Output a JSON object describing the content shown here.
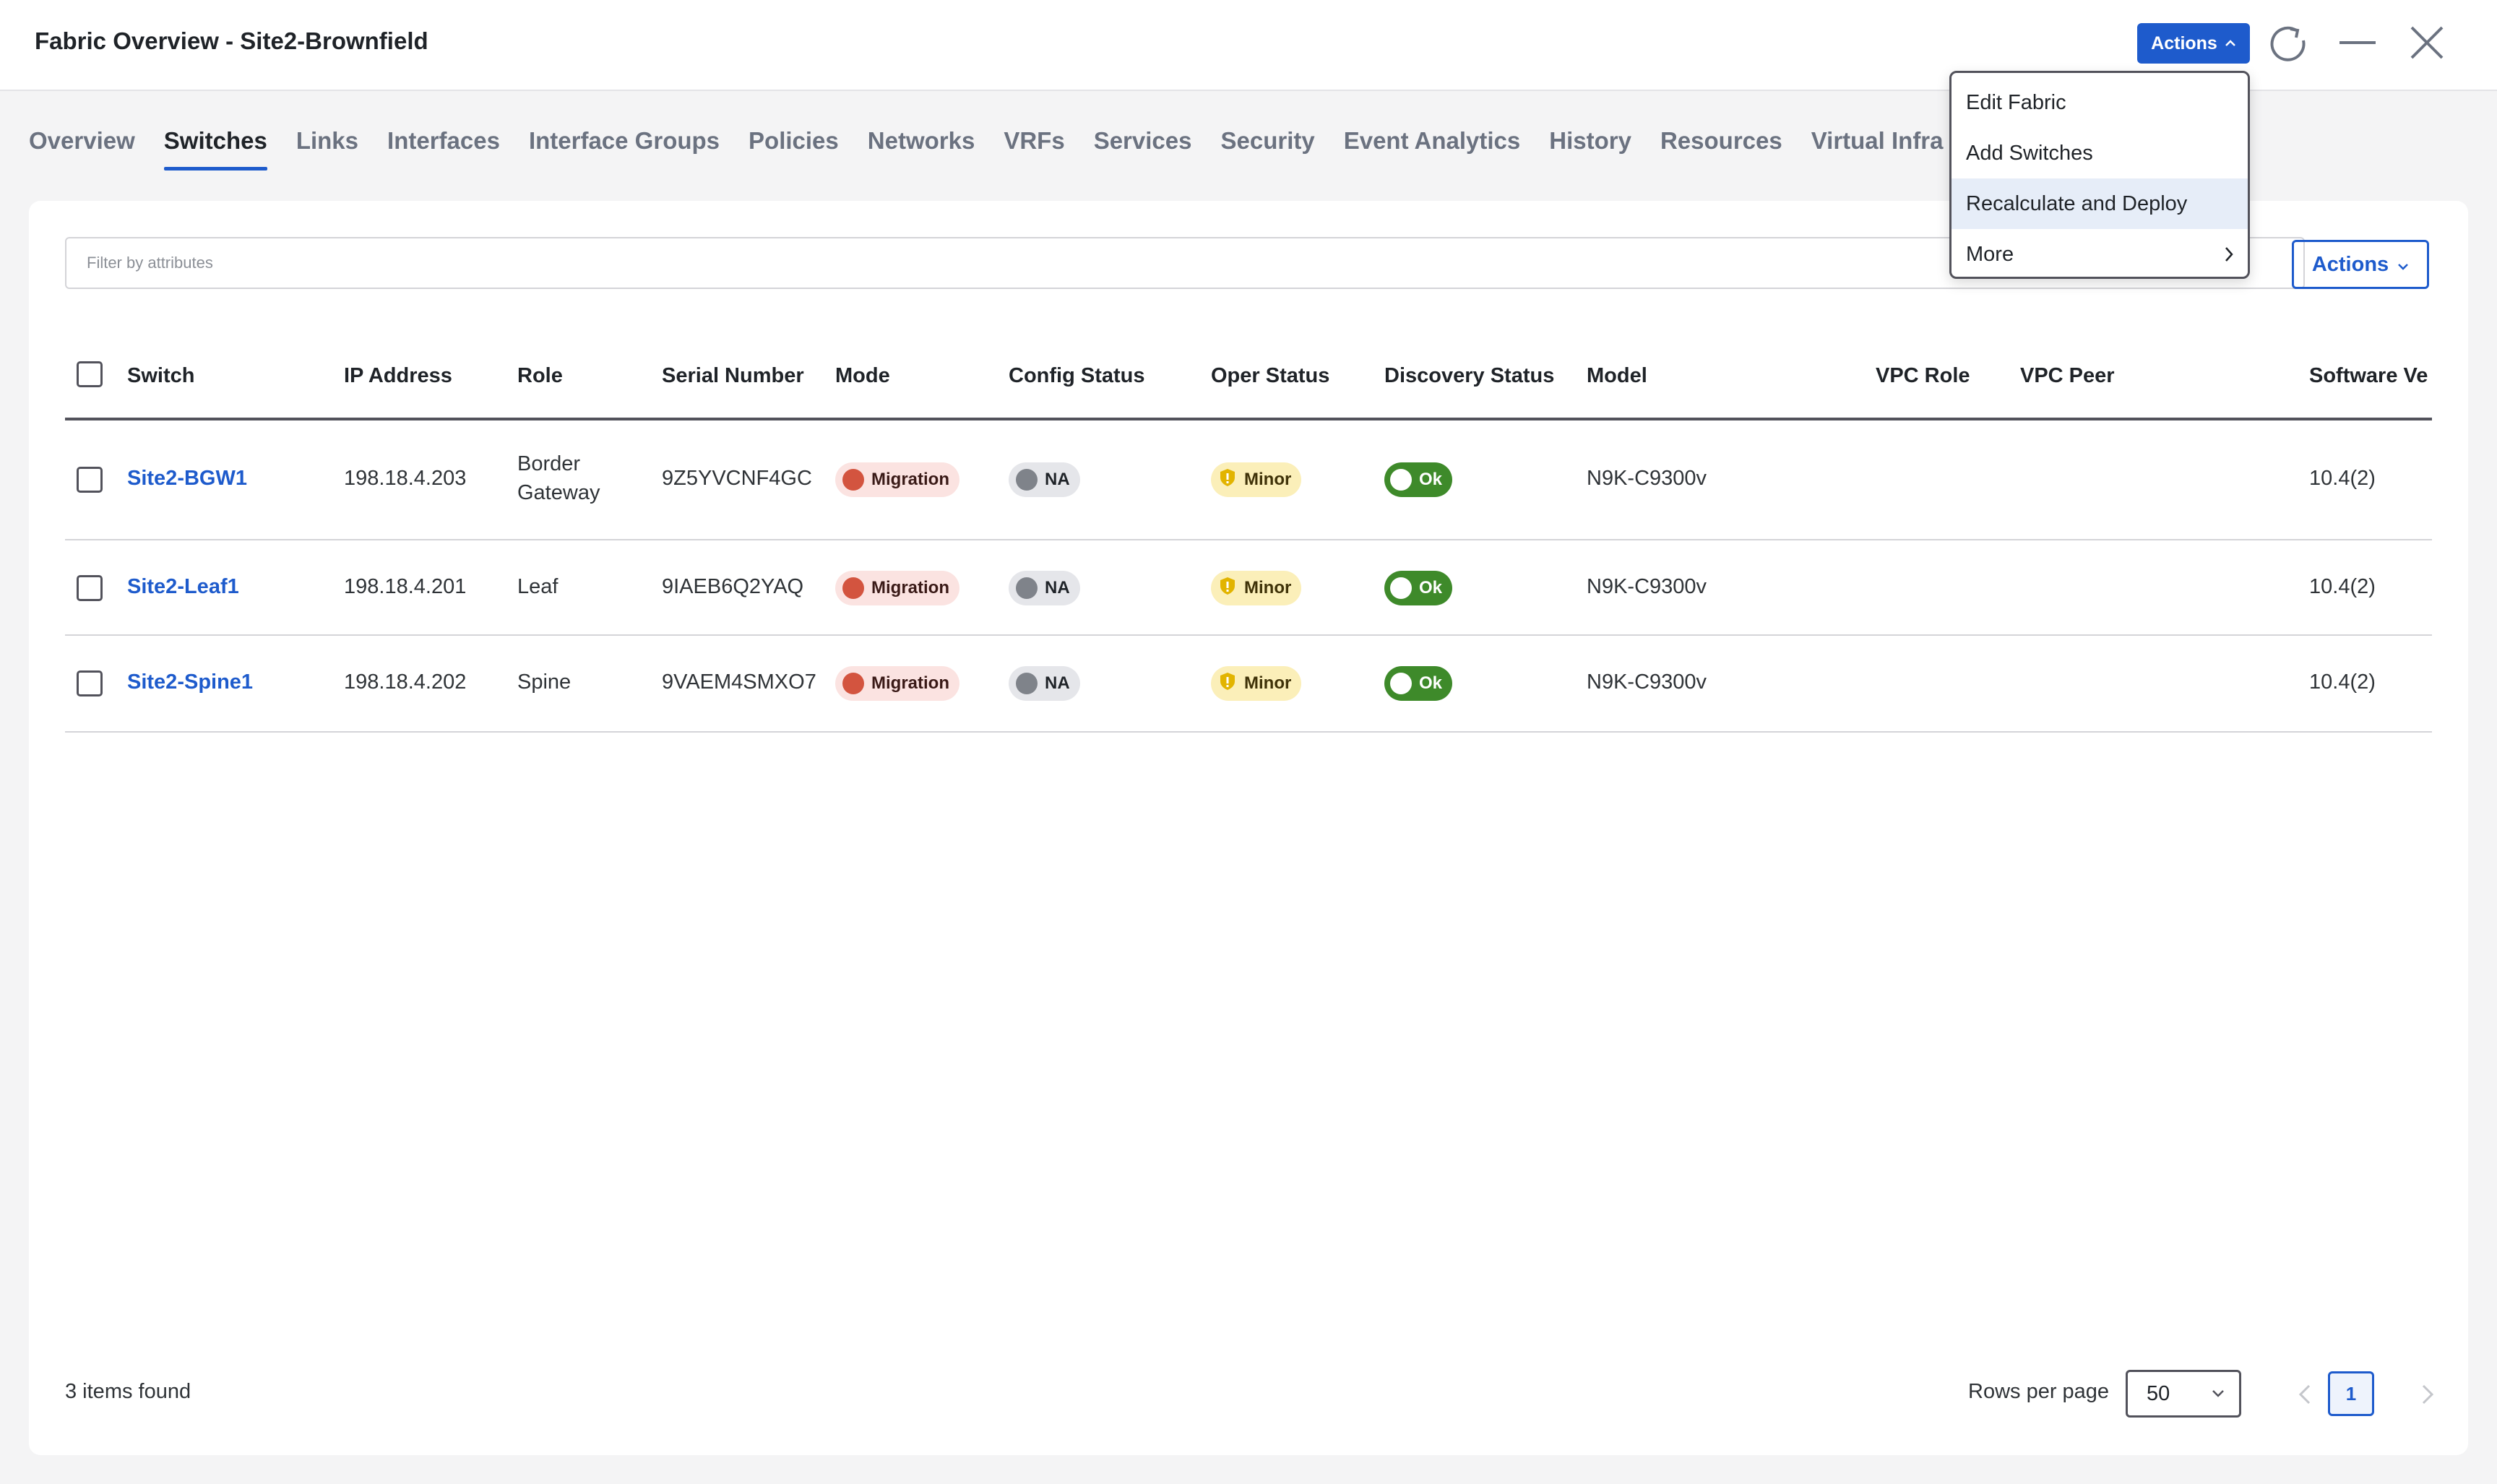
{
  "header": {
    "title": "Fabric Overview - Site2-Brownfield",
    "actions_label": "Actions"
  },
  "tabs": [
    {
      "label": "Overview"
    },
    {
      "label": "Switches"
    },
    {
      "label": "Links"
    },
    {
      "label": "Interfaces"
    },
    {
      "label": "Interface Groups"
    },
    {
      "label": "Policies"
    },
    {
      "label": "Networks"
    },
    {
      "label": "VRFs"
    },
    {
      "label": "Services"
    },
    {
      "label": "Security"
    },
    {
      "label": "Event Analytics"
    },
    {
      "label": "History"
    },
    {
      "label": "Resources"
    },
    {
      "label": "Virtual Infra"
    }
  ],
  "active_tab": "Switches",
  "filter": {
    "placeholder": "Filter by attributes"
  },
  "card_actions_label": "Actions",
  "table": {
    "columns": [
      "Switch",
      "IP Address",
      "Role",
      "Serial Number",
      "Mode",
      "Config Status",
      "Oper Status",
      "Discovery Status",
      "Model",
      "VPC Role",
      "VPC Peer",
      "Software Ve"
    ],
    "rows": [
      {
        "switch": "Site2-BGW1",
        "ip": "198.18.4.203",
        "role_line1": "Border",
        "role_line2": "Gateway",
        "serial": "9Z5YVCNF4GC",
        "mode": "Migration",
        "config": "NA",
        "oper": "Minor",
        "discovery": "Ok",
        "model": "N9K-C9300v",
        "vpc_role": "",
        "vpc_peer": "",
        "software": "10.4(2)"
      },
      {
        "switch": "Site2-Leaf1",
        "ip": "198.18.4.201",
        "role_line1": "Leaf",
        "role_line2": "",
        "serial": "9IAEB6Q2YAQ",
        "mode": "Migration",
        "config": "NA",
        "oper": "Minor",
        "discovery": "Ok",
        "model": "N9K-C9300v",
        "vpc_role": "",
        "vpc_peer": "",
        "software": "10.4(2)"
      },
      {
        "switch": "Site2-Spine1",
        "ip": "198.18.4.202",
        "role_line1": "Spine",
        "role_line2": "",
        "serial": "9VAEM4SMXO7",
        "mode": "Migration",
        "config": "NA",
        "oper": "Minor",
        "discovery": "Ok",
        "model": "N9K-C9300v",
        "vpc_role": "",
        "vpc_peer": "",
        "software": "10.4(2)"
      }
    ]
  },
  "footer": {
    "items_found": "3 items found",
    "rows_per_page_label": "Rows per page",
    "rows_per_page_value": "50",
    "current_page": "1"
  },
  "dropdown": {
    "items": [
      {
        "label": "Edit Fabric"
      },
      {
        "label": "Add Switches"
      },
      {
        "label": "Recalculate and Deploy"
      },
      {
        "label": "More"
      }
    ]
  },
  "colors": {
    "accent": "#1e5bcc",
    "migration": "#d3543f",
    "ok": "#3e8a2a",
    "minor": "#fbefb9"
  }
}
